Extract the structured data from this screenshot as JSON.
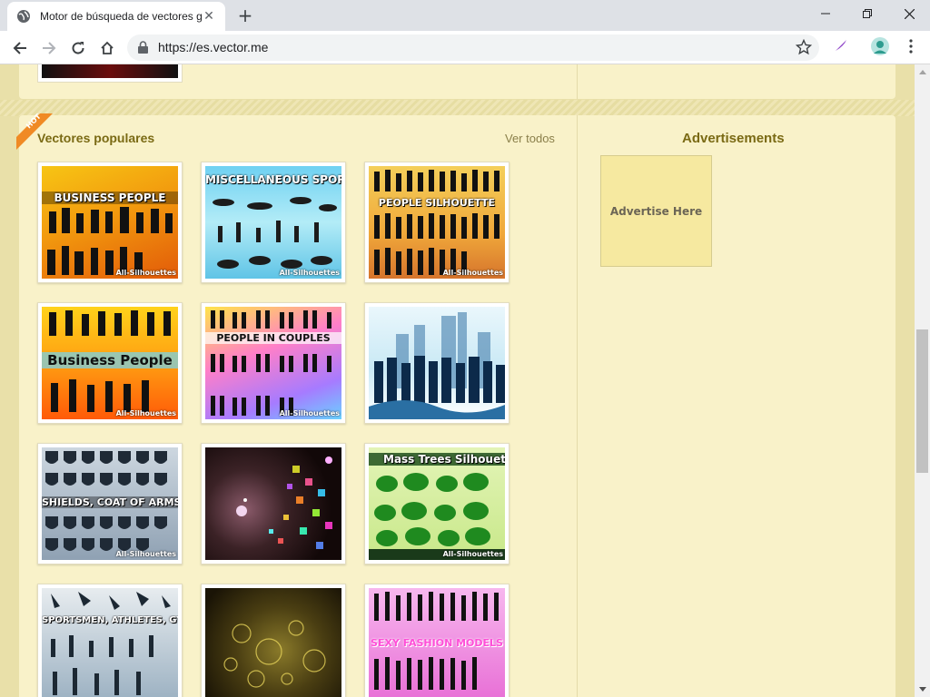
{
  "browser": {
    "tab_title": "Motor de búsqueda de vectores gratis",
    "url": "https://es.vector.me",
    "new_tab": "+"
  },
  "page": {
    "section_title": "Vectores populares",
    "see_all": "Ver todos",
    "hot_badge": "HOT",
    "ads_title": "Advertisements",
    "ad_text": "Advertise Here",
    "thumb_brand": "All-Silhouettes",
    "thumbnails": [
      {
        "label": "BUSINESS PEOPLE"
      },
      {
        "label": "MISCELLANEOUS SPORTSMEN"
      },
      {
        "label": "PEOPLE SILHOUETTE"
      },
      {
        "label": "Business People"
      },
      {
        "label": "PEOPLE IN COUPLES"
      },
      {
        "label": ""
      },
      {
        "label": "SHIELDS, COAT OF ARMS"
      },
      {
        "label": ""
      },
      {
        "label": "Mass Trees Silhouettes"
      },
      {
        "label": "SPORTSMEN, ATHLETES, GYMNASTS"
      },
      {
        "label": ""
      },
      {
        "label": "SEXY FASHION MODELS"
      }
    ]
  },
  "colors": {
    "page_bg": "#e9e0a9",
    "panel_bg": "#f9f2c9",
    "heading": "#7a6a14",
    "hot_orange": "#f08a24"
  }
}
